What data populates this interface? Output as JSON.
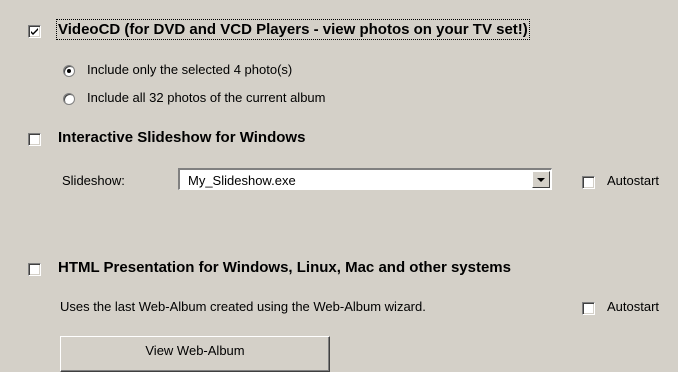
{
  "videocd": {
    "checked": true,
    "label": "VideoCD (for DVD and VCD Players - view photos on your TV set!)",
    "options": [
      {
        "label": "Include only the selected 4 photo(s)",
        "selected": true
      },
      {
        "label": "Include all 32 photos of the current album",
        "selected": false
      }
    ]
  },
  "slideshow": {
    "checked": false,
    "label": "Interactive Slideshow for Windows",
    "field_label": "Slideshow:",
    "selected_value": "My_Slideshow.exe",
    "autostart_checked": false,
    "autostart_label": "Autostart"
  },
  "html": {
    "checked": false,
    "label": "HTML Presentation for Windows, Linux, Mac and other systems",
    "description": "Uses the last Web-Album created using the Web-Album wizard.",
    "autostart_checked": false,
    "autostart_label": "Autostart",
    "view_button": "View Web-Album"
  },
  "icons": {
    "checkmark": "checkmark-icon",
    "dropdown": "chevron-down-icon"
  }
}
